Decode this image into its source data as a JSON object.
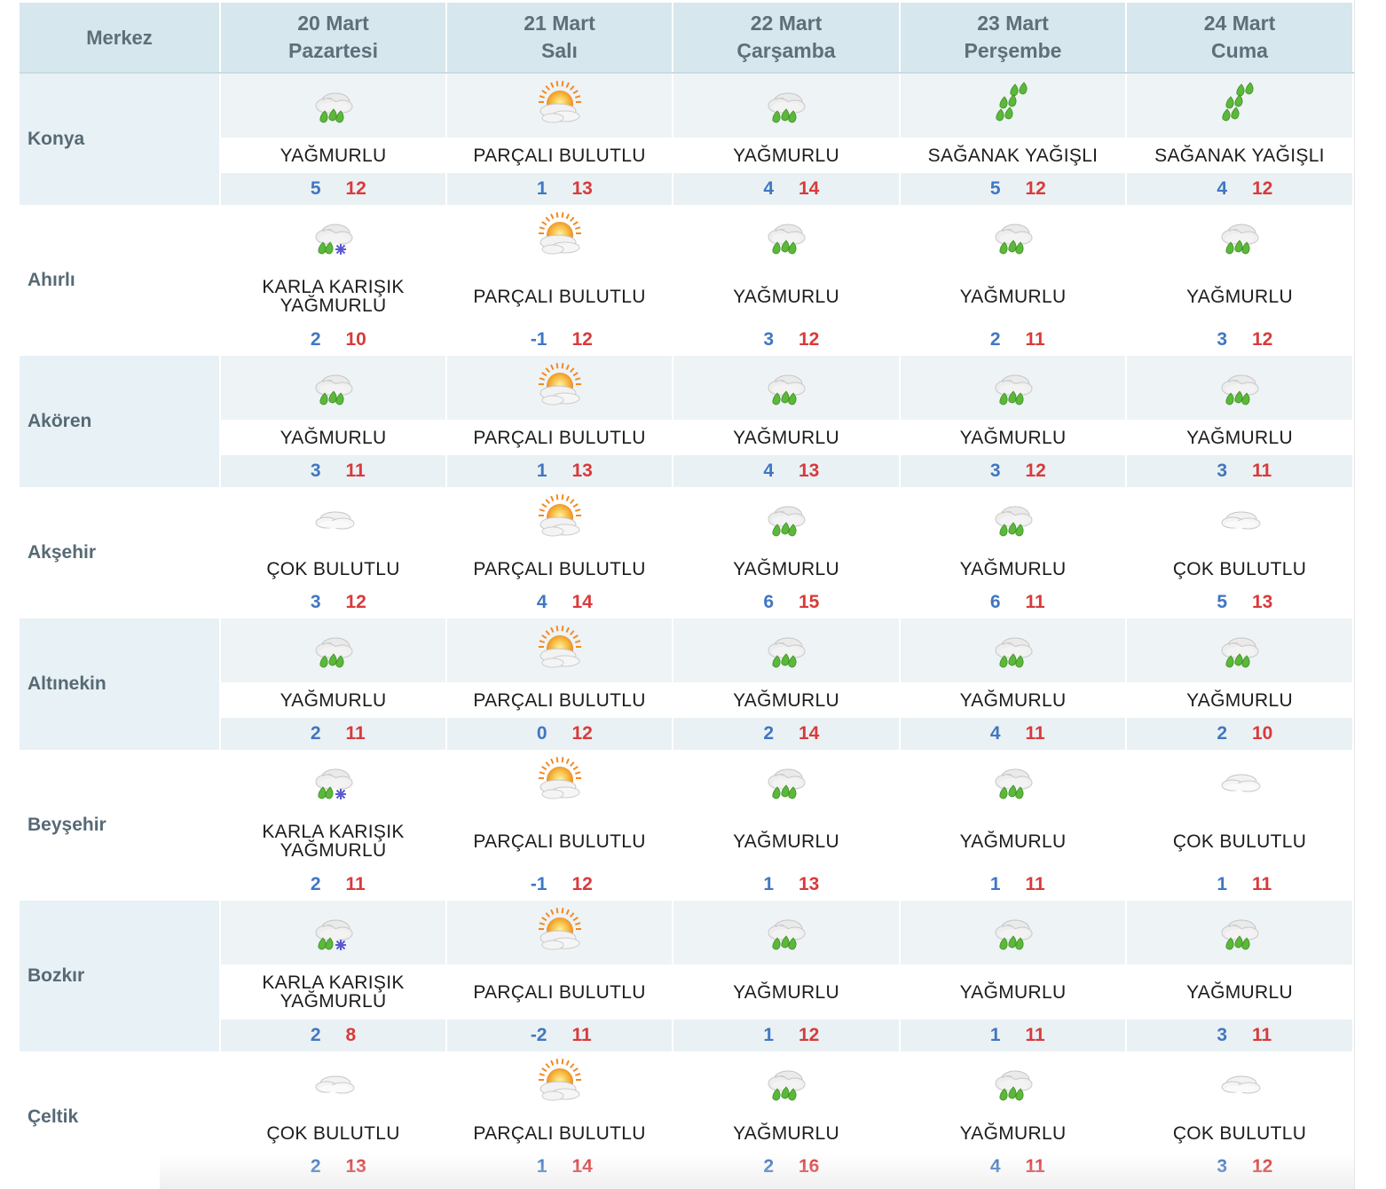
{
  "header": {
    "merkez": "Merkez",
    "days": [
      {
        "date": "20 Mart",
        "weekday": "Pazartesi"
      },
      {
        "date": "21 Mart",
        "weekday": "Salı"
      },
      {
        "date": "22 Mart",
        "weekday": "Çarşamba"
      },
      {
        "date": "23 Mart",
        "weekday": "Perşembe"
      },
      {
        "date": "24 Mart",
        "weekday": "Cuma"
      }
    ]
  },
  "colors": {
    "min_temp": "#3f77c2",
    "max_temp": "#d93a3a",
    "header_bg": "#d6e7ee",
    "shaded_row_bg": "#e8f1f5"
  },
  "rows": [
    {
      "city": "Konya",
      "shaded": true,
      "days": [
        {
          "icon": "rain-icon",
          "desc": "YAĞMURLU",
          "min": "5",
          "max": "12"
        },
        {
          "icon": "partly-cloudy-icon",
          "desc": "PARÇALI BULUTLU",
          "min": "1",
          "max": "13"
        },
        {
          "icon": "rain-icon",
          "desc": "YAĞMURLU",
          "min": "4",
          "max": "14"
        },
        {
          "icon": "showers-icon",
          "desc": "SAĞANAK YAĞIŞLI",
          "min": "5",
          "max": "12"
        },
        {
          "icon": "showers-icon",
          "desc": "SAĞANAK YAĞIŞLI",
          "min": "4",
          "max": "12"
        }
      ]
    },
    {
      "city": "Ahırlı",
      "shaded": false,
      "days": [
        {
          "icon": "sleet-icon",
          "desc": "KARLA KARIŞIK YAĞMURLU",
          "min": "2",
          "max": "10"
        },
        {
          "icon": "partly-cloudy-icon",
          "desc": "PARÇALI BULUTLU",
          "min": "-1",
          "max": "12"
        },
        {
          "icon": "rain-icon",
          "desc": "YAĞMURLU",
          "min": "3",
          "max": "12"
        },
        {
          "icon": "rain-icon",
          "desc": "YAĞMURLU",
          "min": "2",
          "max": "11"
        },
        {
          "icon": "rain-icon",
          "desc": "YAĞMURLU",
          "min": "3",
          "max": "12"
        }
      ]
    },
    {
      "city": "Akören",
      "shaded": true,
      "days": [
        {
          "icon": "rain-icon",
          "desc": "YAĞMURLU",
          "min": "3",
          "max": "11"
        },
        {
          "icon": "partly-cloudy-icon",
          "desc": "PARÇALI BULUTLU",
          "min": "1",
          "max": "13"
        },
        {
          "icon": "rain-icon",
          "desc": "YAĞMURLU",
          "min": "4",
          "max": "13"
        },
        {
          "icon": "rain-icon",
          "desc": "YAĞMURLU",
          "min": "3",
          "max": "12"
        },
        {
          "icon": "rain-icon",
          "desc": "YAĞMURLU",
          "min": "3",
          "max": "11"
        }
      ]
    },
    {
      "city": "Akşehir",
      "shaded": false,
      "days": [
        {
          "icon": "cloudy-icon",
          "desc": "ÇOK BULUTLU",
          "min": "3",
          "max": "12"
        },
        {
          "icon": "partly-cloudy-icon",
          "desc": "PARÇALI BULUTLU",
          "min": "4",
          "max": "14"
        },
        {
          "icon": "rain-icon",
          "desc": "YAĞMURLU",
          "min": "6",
          "max": "15"
        },
        {
          "icon": "rain-icon",
          "desc": "YAĞMURLU",
          "min": "6",
          "max": "11"
        },
        {
          "icon": "cloudy-icon",
          "desc": "ÇOK BULUTLU",
          "min": "5",
          "max": "13"
        }
      ]
    },
    {
      "city": "Altınekin",
      "shaded": true,
      "days": [
        {
          "icon": "rain-icon",
          "desc": "YAĞMURLU",
          "min": "2",
          "max": "11"
        },
        {
          "icon": "partly-cloudy-icon",
          "desc": "PARÇALI BULUTLU",
          "min": "0",
          "max": "12"
        },
        {
          "icon": "rain-icon",
          "desc": "YAĞMURLU",
          "min": "2",
          "max": "14"
        },
        {
          "icon": "rain-icon",
          "desc": "YAĞMURLU",
          "min": "4",
          "max": "11"
        },
        {
          "icon": "rain-icon",
          "desc": "YAĞMURLU",
          "min": "2",
          "max": "10"
        }
      ]
    },
    {
      "city": "Beyşehir",
      "shaded": false,
      "days": [
        {
          "icon": "sleet-icon",
          "desc": "KARLA KARIŞIK YAĞMURLU",
          "min": "2",
          "max": "11"
        },
        {
          "icon": "partly-cloudy-icon",
          "desc": "PARÇALI BULUTLU",
          "min": "-1",
          "max": "12"
        },
        {
          "icon": "rain-icon",
          "desc": "YAĞMURLU",
          "min": "1",
          "max": "13"
        },
        {
          "icon": "rain-icon",
          "desc": "YAĞMURLU",
          "min": "1",
          "max": "11"
        },
        {
          "icon": "cloudy-icon",
          "desc": "ÇOK BULUTLU",
          "min": "1",
          "max": "11"
        }
      ]
    },
    {
      "city": "Bozkır",
      "shaded": true,
      "days": [
        {
          "icon": "sleet-icon",
          "desc": "KARLA KARIŞIK YAĞMURLU",
          "min": "2",
          "max": "8"
        },
        {
          "icon": "partly-cloudy-icon",
          "desc": "PARÇALI BULUTLU",
          "min": "-2",
          "max": "11"
        },
        {
          "icon": "rain-icon",
          "desc": "YAĞMURLU",
          "min": "1",
          "max": "12"
        },
        {
          "icon": "rain-icon",
          "desc": "YAĞMURLU",
          "min": "1",
          "max": "11"
        },
        {
          "icon": "rain-icon",
          "desc": "YAĞMURLU",
          "min": "3",
          "max": "11"
        }
      ]
    },
    {
      "city": "Çeltik",
      "shaded": false,
      "days": [
        {
          "icon": "cloudy-icon",
          "desc": "ÇOK BULUTLU",
          "min": "2",
          "max": "13"
        },
        {
          "icon": "partly-cloudy-icon",
          "desc": "PARÇALI BULUTLU",
          "min": "1",
          "max": "14"
        },
        {
          "icon": "rain-icon",
          "desc": "YAĞMURLU",
          "min": "2",
          "max": "16"
        },
        {
          "icon": "rain-icon",
          "desc": "YAĞMURLU",
          "min": "4",
          "max": "11"
        },
        {
          "icon": "cloudy-icon",
          "desc": "ÇOK BULUTLU",
          "min": "3",
          "max": "12"
        }
      ]
    }
  ]
}
